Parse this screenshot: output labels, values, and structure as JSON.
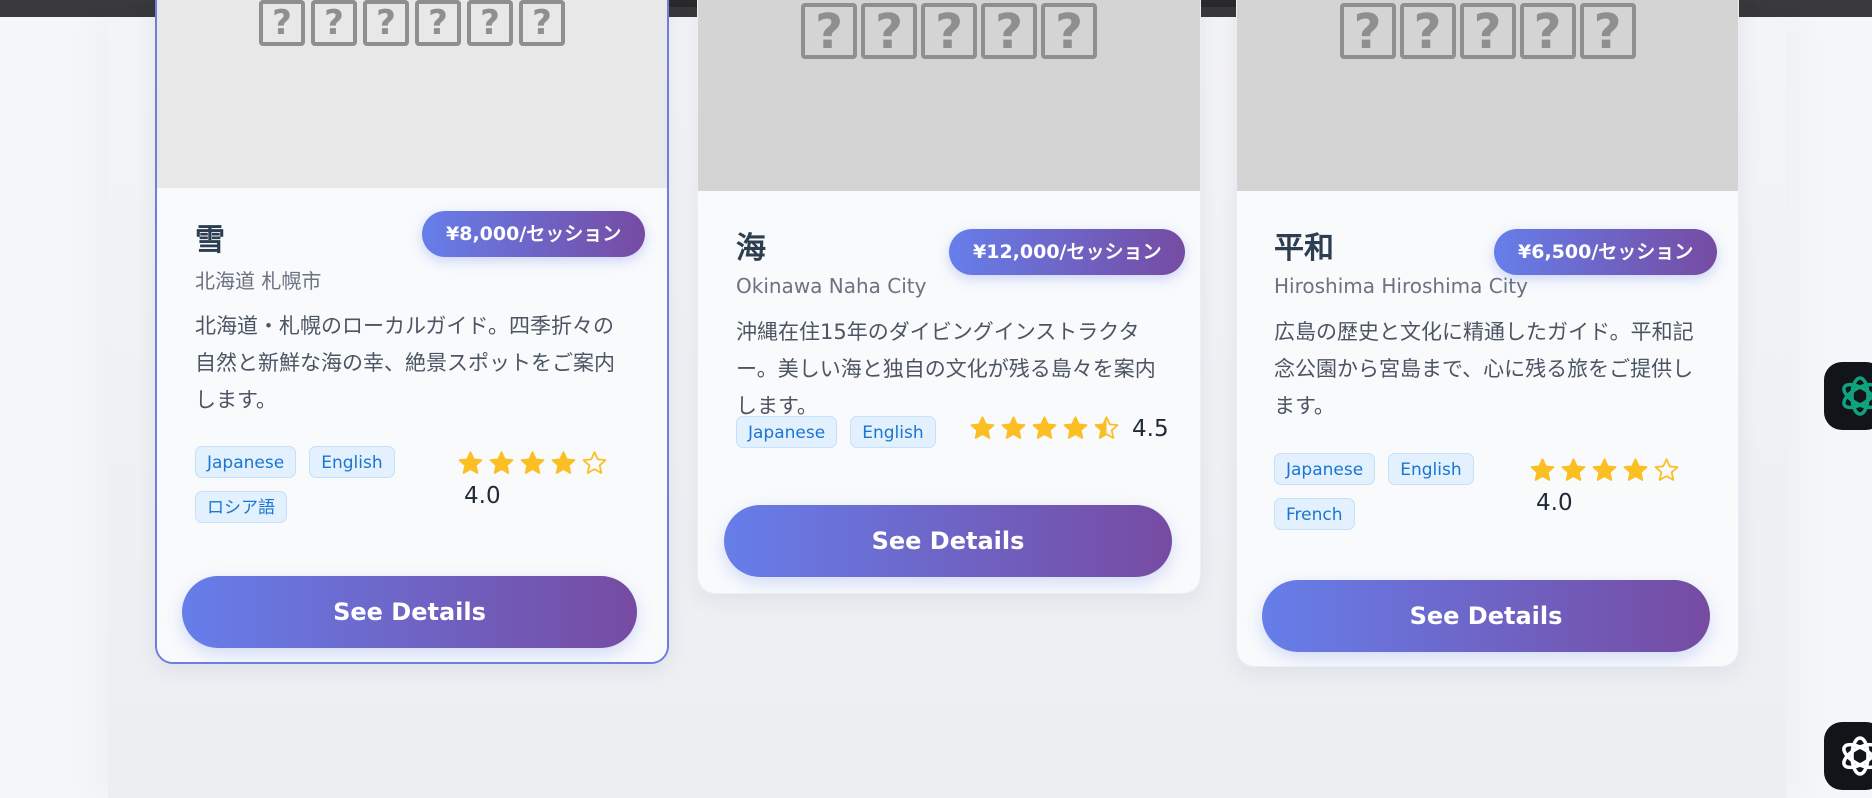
{
  "colors": {
    "accent_gradient_start": "#667eea",
    "accent_gradient_end": "#764ba2",
    "star": "#fbbf24",
    "tag_text": "#1976d2",
    "tag_bg": "#e3f0fd"
  },
  "cards": [
    {
      "image_placeholder": "??????",
      "name": "雪",
      "price": "¥8,000/セッション",
      "location": "北海道 札幌市",
      "description": "北海道・札幌のローカルガイド。四季折々の自然と新鮮な海の幸、絶景スポットをご案内します。",
      "languages": [
        "Japanese",
        "English",
        "ロシア語"
      ],
      "rating_value": "4.0",
      "rating": 4.0,
      "button_label": "See Details"
    },
    {
      "image_placeholder": "?????",
      "name": "海",
      "price": "¥12,000/セッション",
      "location": "Okinawa Naha City",
      "description": "沖縄在住15年のダイビングインストラクター。美しい海と独自の文化が残る島々を案内します。",
      "languages": [
        "Japanese",
        "English"
      ],
      "rating_value": "4.5",
      "rating": 4.5,
      "button_label": "See Details"
    },
    {
      "image_placeholder": "?????",
      "name": "平和",
      "price": "¥6,500/セッション",
      "location": "Hiroshima Hiroshima City",
      "description": "広島の歴史と文化に精通したガイド。平和記念公園から宮島まで、心に残る旅をご提供します。",
      "languages": [
        "Japanese",
        "English",
        "French"
      ],
      "rating_value": "4.0",
      "rating": 4.0,
      "button_label": "See Details"
    }
  ],
  "side_buttons": [
    {
      "icon": "chatgpt-green-icon"
    },
    {
      "icon": "openai-logo-icon"
    }
  ]
}
